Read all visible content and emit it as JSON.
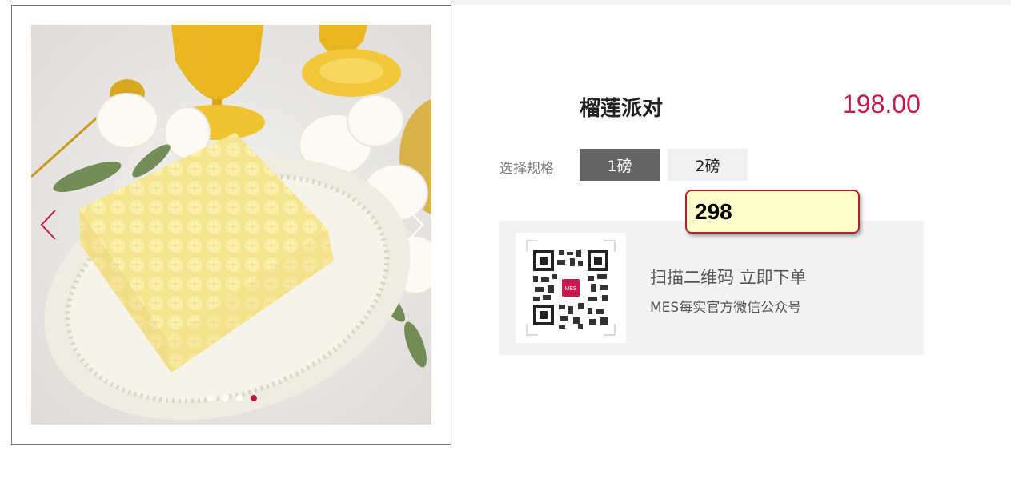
{
  "product": {
    "name": "榴莲派对",
    "price": "198.00",
    "image_alt": "cake-photo"
  },
  "gallery": {
    "dot_count": 4,
    "active_dot": 4
  },
  "spec": {
    "label": "选择规格",
    "options": [
      "1磅",
      "2磅"
    ],
    "selected": "1磅"
  },
  "tooltip": {
    "value": "298"
  },
  "qr": {
    "logo_text": "MES",
    "title": "扫描二维码 立即下单",
    "subtitle": "MES每实官方微信公众号"
  },
  "colors": {
    "accent": "#c8174b",
    "selected_spec_bg": "#646464",
    "panel_bg": "#f2f2f2",
    "tooltip_bg": "#ffffcc",
    "tooltip_border": "#b5202e"
  }
}
